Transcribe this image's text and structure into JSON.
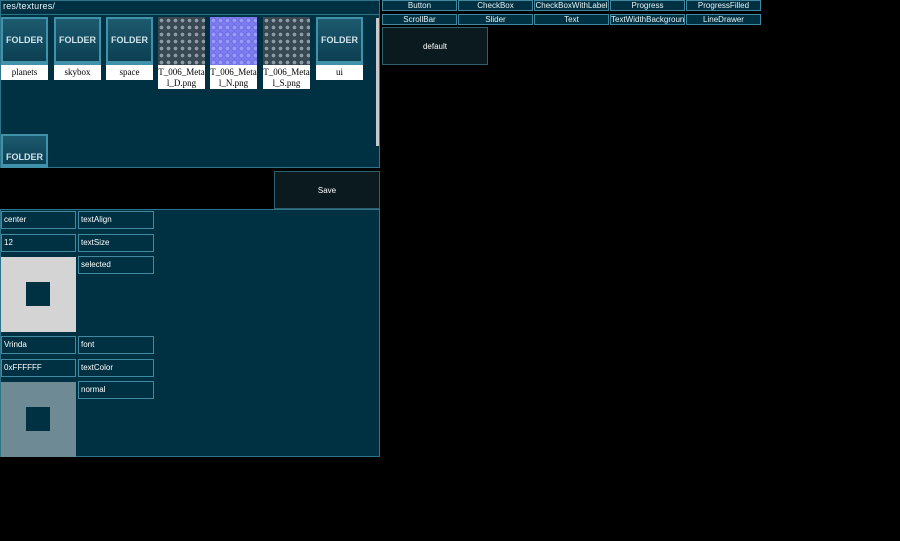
{
  "browser": {
    "path": "res/textures/",
    "items": [
      {
        "name": "planets",
        "thumb": "FOLDER"
      },
      {
        "name": "skybox",
        "thumb": "FOLDER"
      },
      {
        "name": "space",
        "thumb": "FOLDER"
      },
      {
        "name": "T_006_Metal_D.png",
        "thumb": ""
      },
      {
        "name": "T_006_Metal_N.png",
        "thumb": ""
      },
      {
        "name": "T_006_Metal_S.png",
        "thumb": ""
      },
      {
        "name": "ui",
        "thumb": "FOLDER"
      },
      {
        "name": "",
        "thumb": "FOLDER"
      }
    ]
  },
  "save_label": "Save",
  "properties": {
    "text_align": {
      "value": "center",
      "label": "textAlign"
    },
    "text_size": {
      "value": "12",
      "label": "textSize"
    },
    "selected": {
      "label": "selected",
      "color": "#d4d4d4"
    },
    "font": {
      "value": "Vrinda",
      "label": "font"
    },
    "text_color": {
      "value": "0xFFFFFF",
      "label": "textColor"
    },
    "normal": {
      "label": "normal",
      "color": "#6e8a94"
    }
  },
  "widget_tabs": {
    "row1": [
      "Button",
      "CheckBox",
      "CheckBoxWithLabel",
      "Progress",
      "ProgressFilled"
    ],
    "row2": [
      "ScrollBar",
      "Slider",
      "Text",
      "TextWidthBackground",
      "LineDrawer"
    ]
  },
  "default_label": "default",
  "colors": {
    "panel": "#003142",
    "border": "#3f8aa0",
    "dark_button": "#0a1a1f"
  }
}
